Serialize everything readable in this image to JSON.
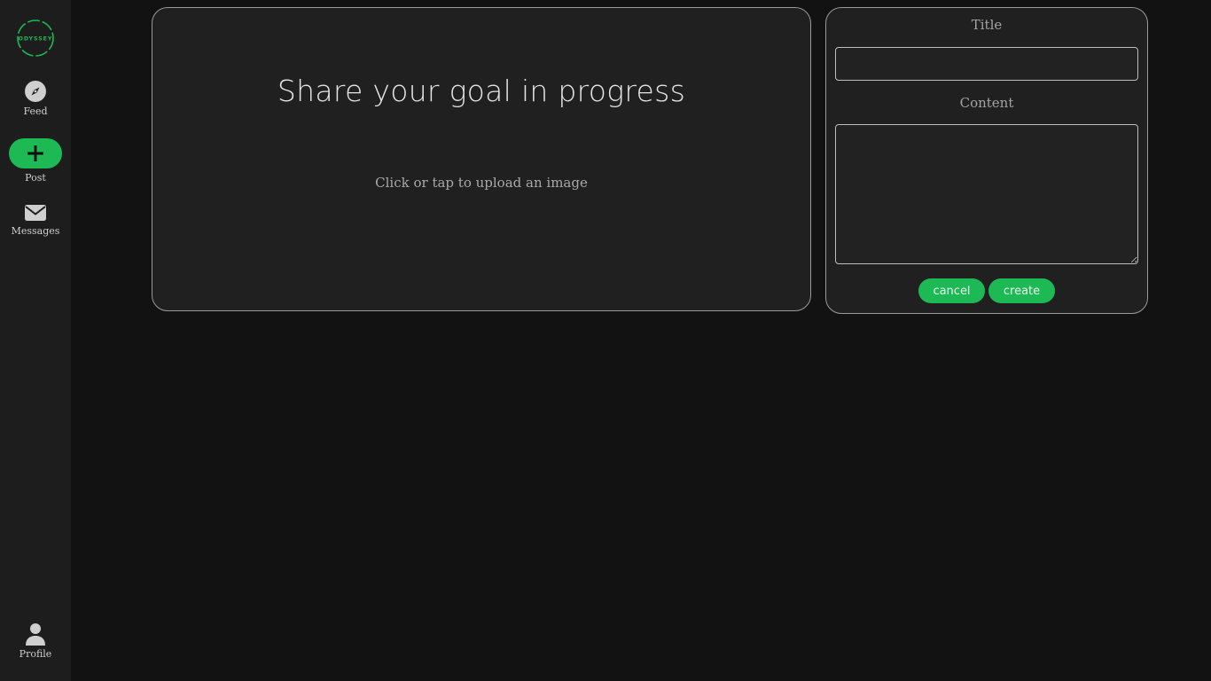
{
  "app": {
    "logo_text": "ODYSSEY",
    "accent_color": "#1db954"
  },
  "sidebar": {
    "items": [
      {
        "label": "Feed",
        "icon": "compass-icon"
      },
      {
        "label": "Post",
        "icon": "plus-icon"
      },
      {
        "label": "Messages",
        "icon": "envelope-icon"
      }
    ],
    "profile": {
      "label": "Profile",
      "icon": "user-icon"
    }
  },
  "upload": {
    "title": "Share your goal in progress",
    "hint": "Click or tap to upload an image"
  },
  "form": {
    "title_label": "Title",
    "title_value": "",
    "content_label": "Content",
    "content_value": "",
    "cancel_label": "cancel",
    "create_label": "create"
  }
}
